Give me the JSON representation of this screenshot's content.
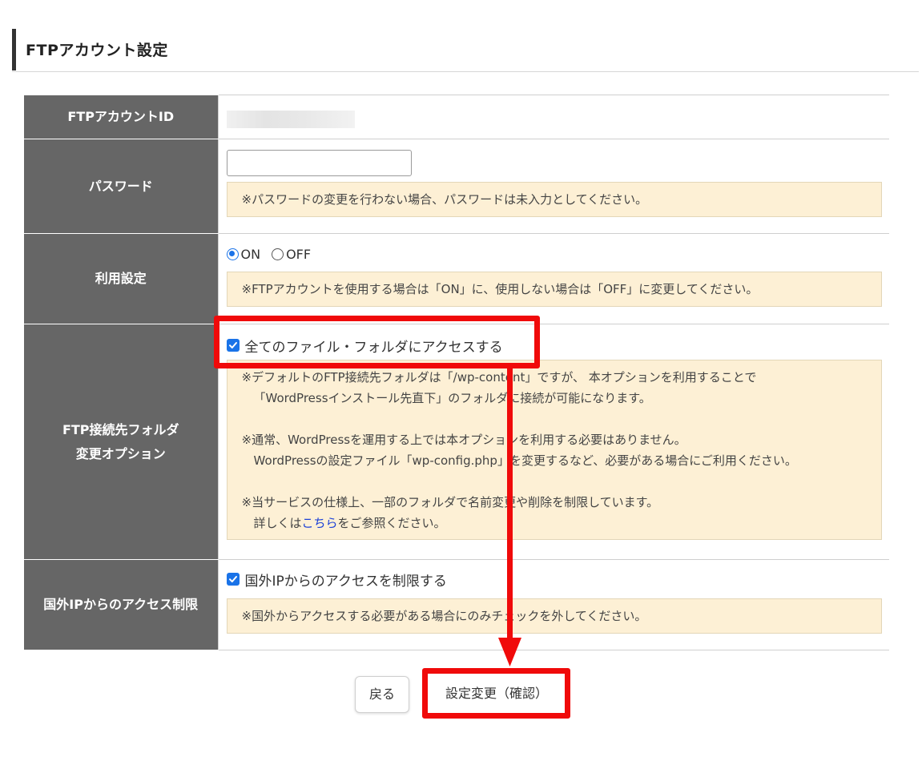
{
  "page": {
    "title": "FTPアカウント設定"
  },
  "form": {
    "account_id": {
      "label": "FTPアカウントID",
      "value": ""
    },
    "password": {
      "label": "パスワード",
      "value": "",
      "note": "※パスワードの変更を行わない場合、パスワードは未入力としてください。"
    },
    "usage": {
      "label": "利用設定",
      "options": [
        "ON",
        "OFF"
      ],
      "selected": "ON",
      "note": "※FTPアカウントを使用する場合は「ON」に、使用しない場合は「OFF」に変更してください。"
    },
    "folder_option": {
      "label_line1": "FTP接続先フォルダ",
      "label_line2": "変更オプション",
      "checkbox_label": "全てのファイル・フォルダにアクセスする",
      "checked": true,
      "note": {
        "line1": "※デフォルトのFTP接続先フォルダは「/wp-content」ですが、 本オプションを利用することで",
        "line2": "「WordPressインストール先直下」のフォルダに接続が可能になります。",
        "line3": "※通常、WordPressを運用する上では本オプションを利用する必要はありません。",
        "line4": "WordPressの設定ファイル「wp-config.php」を変更するなど、必要がある場合にご利用ください。",
        "line5": "※当サービスの仕様上、一部のフォルダで名前変更や削除を制限しています。",
        "line6_prefix": "詳しくは",
        "line6_link": "こちら",
        "line6_suffix": "をご参照ください。"
      }
    },
    "ip_restriction": {
      "label": "国外IPからのアクセス制限",
      "checkbox_label": "国外IPからのアクセスを制限する",
      "checked": true,
      "note": "※国外からアクセスする必要がある場合にのみチェックを外してください。"
    }
  },
  "buttons": {
    "back_label": "戻る",
    "confirm_label": "設定変更（確認）"
  },
  "annotation_color": "#f00a0a",
  "checkbox_color": "#1a73e8"
}
